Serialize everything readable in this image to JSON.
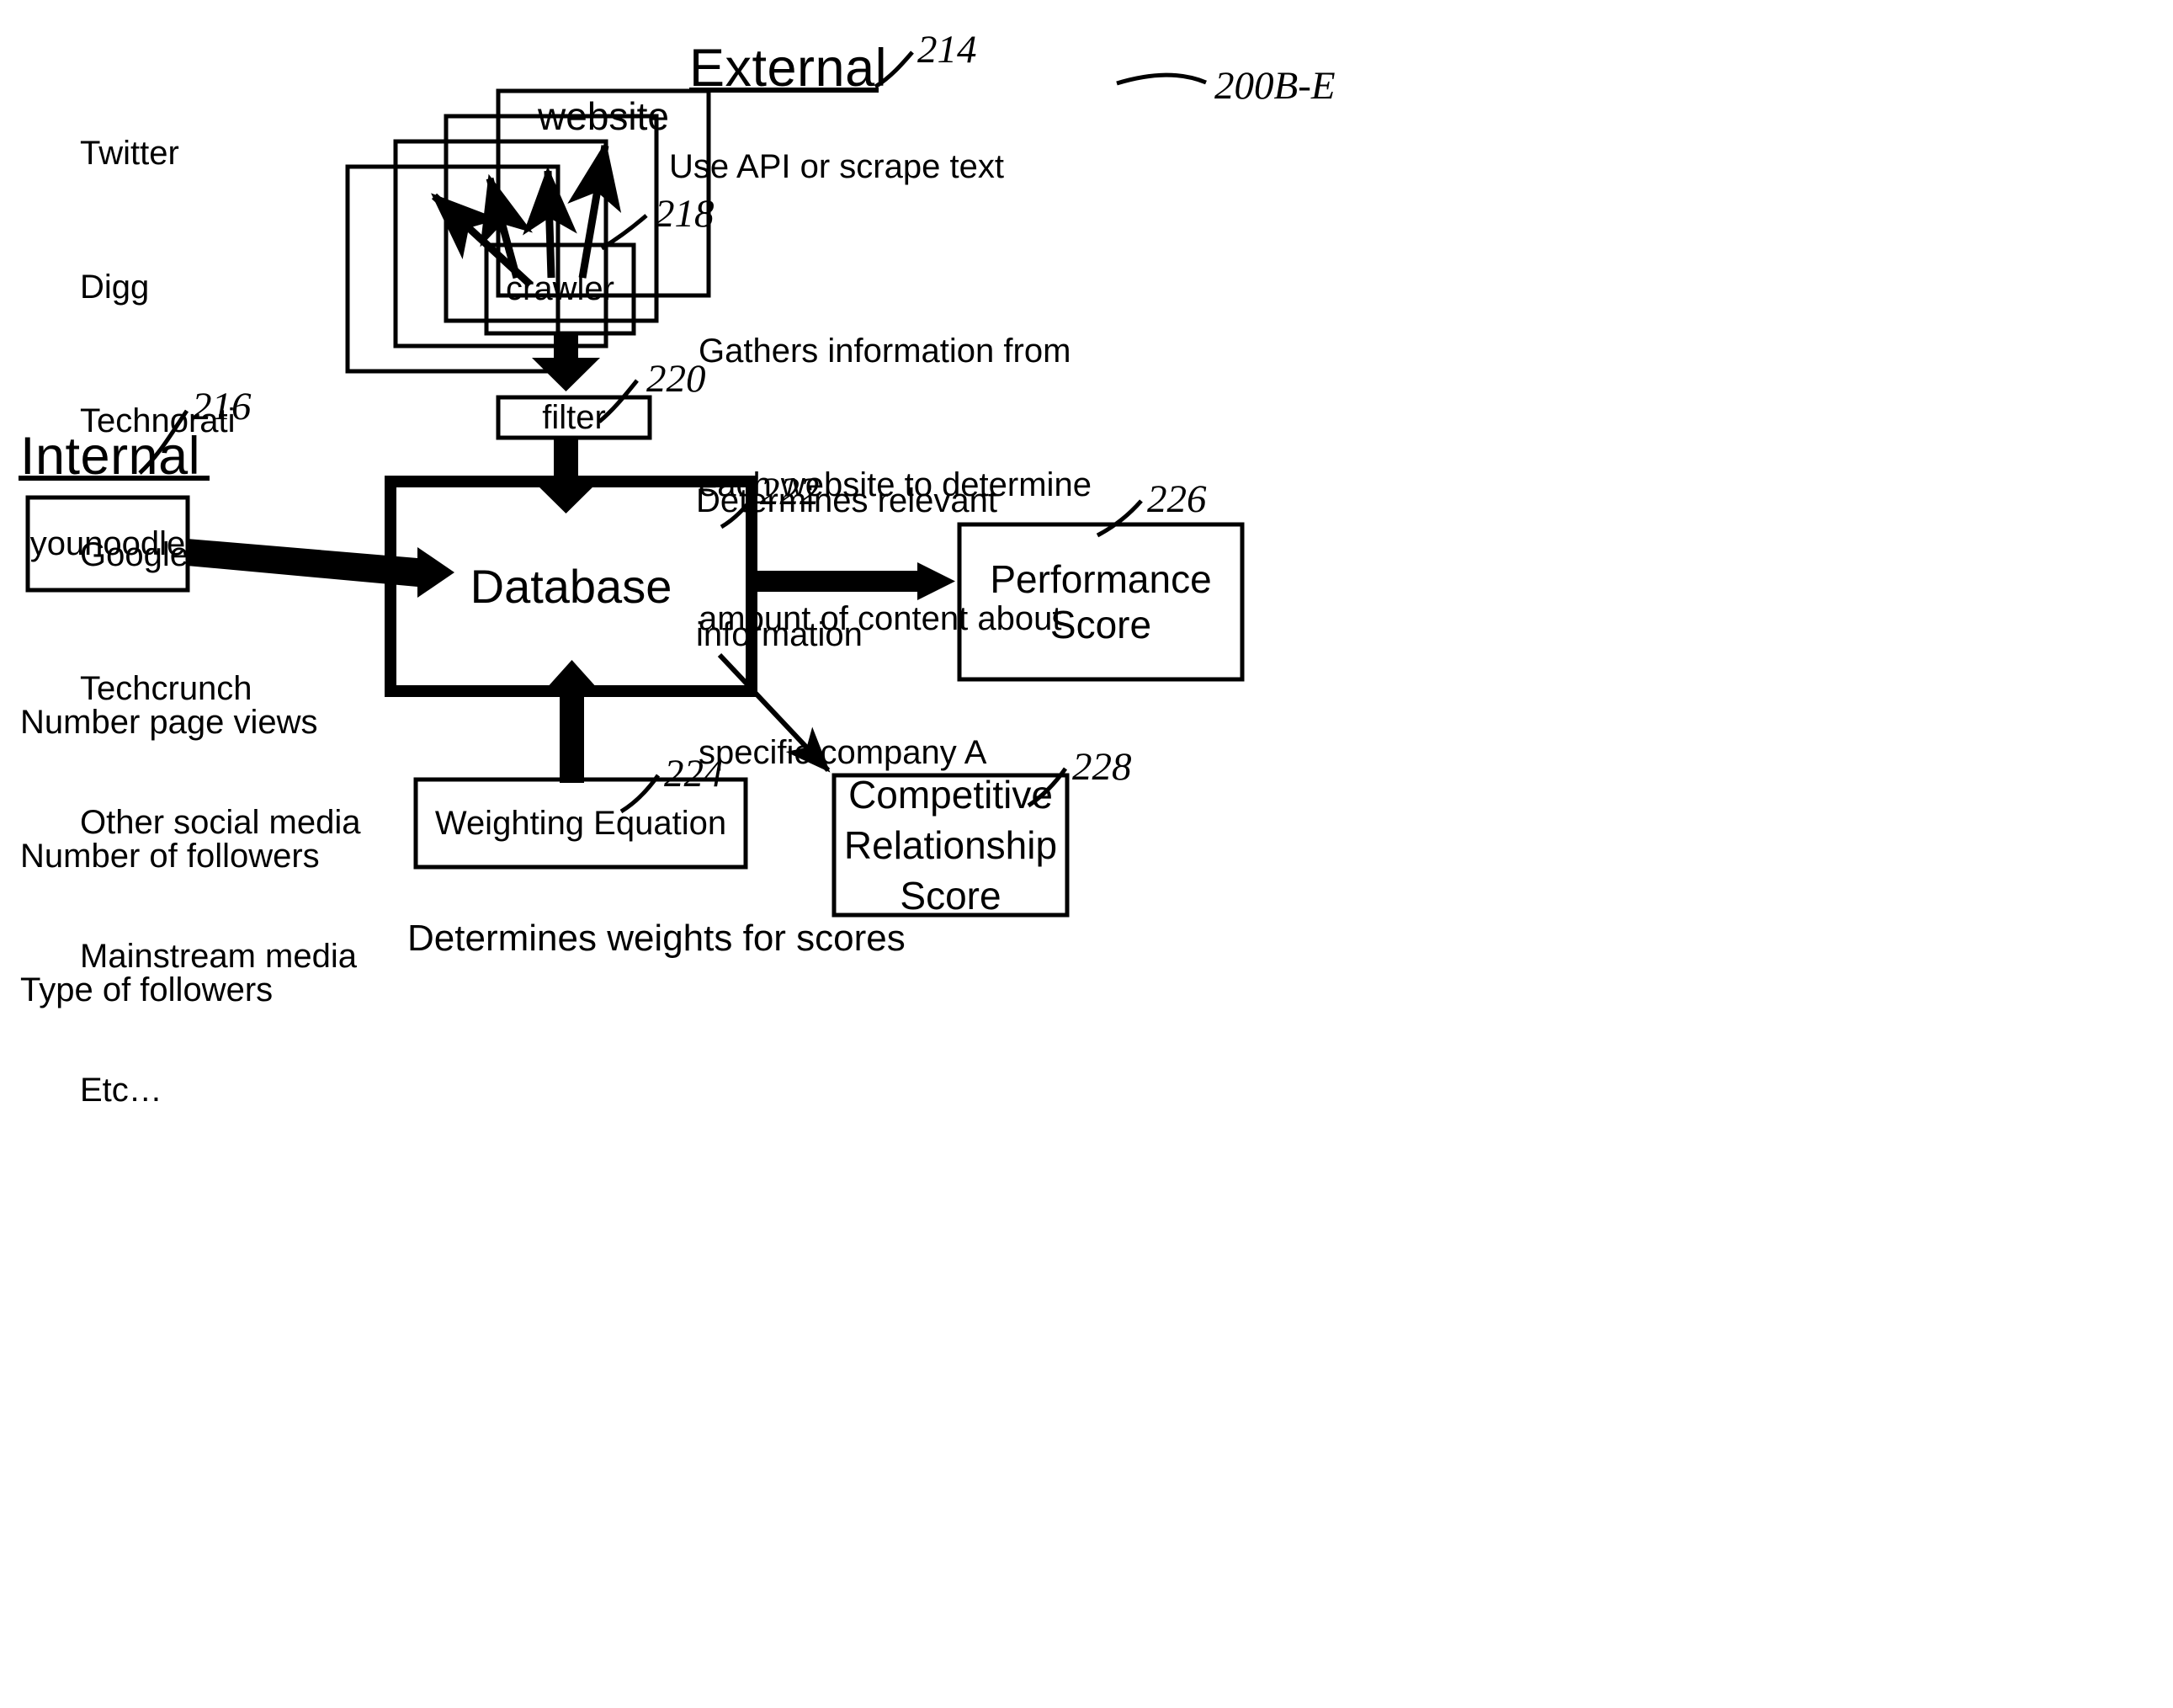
{
  "figure": {
    "figure_ref": "200B-E",
    "caption": "Determines weights for scores"
  },
  "sections": {
    "external": {
      "title": "External",
      "ref": "214"
    },
    "internal": {
      "title": "Internal",
      "ref": "216"
    }
  },
  "source_list": {
    "items": [
      "Twitter",
      "Digg",
      "Technorati",
      "Googlenews",
      "Techcrunch",
      "Other social media",
      "Mainstream media",
      "Etc…"
    ]
  },
  "internal_metrics": {
    "items": [
      "Number page views",
      "Number of followers",
      "Type of followers"
    ]
  },
  "nodes": {
    "website": {
      "label": "website",
      "ref": ""
    },
    "crawler": {
      "label": "crawler",
      "ref": "218"
    },
    "filter": {
      "label": "filter",
      "ref": "220"
    },
    "younoodle": {
      "label": "younoodle",
      "ref": ""
    },
    "database": {
      "label": "Database",
      "ref": "222"
    },
    "weighting_equation": {
      "label": "Weighting Equation",
      "ref": "224"
    },
    "performance_score": {
      "label": "Performance Score",
      "ref": "226"
    },
    "competitive_relationship_score": {
      "label_line1": "Competitive",
      "label_line2": "Relationship",
      "label_line3": "Score",
      "ref": "228"
    }
  },
  "annotations": {
    "api_note": "Use API or scrape text",
    "crawler_note_line1": "Gathers information from",
    "crawler_note_line2": "each website to determine",
    "crawler_note_line3": "amount of content about",
    "crawler_note_line4": "specific company A",
    "filter_note_line1": "Determines relevant",
    "filter_note_line2": "information"
  },
  "colors": {
    "stroke": "#000000",
    "background": "#ffffff"
  }
}
